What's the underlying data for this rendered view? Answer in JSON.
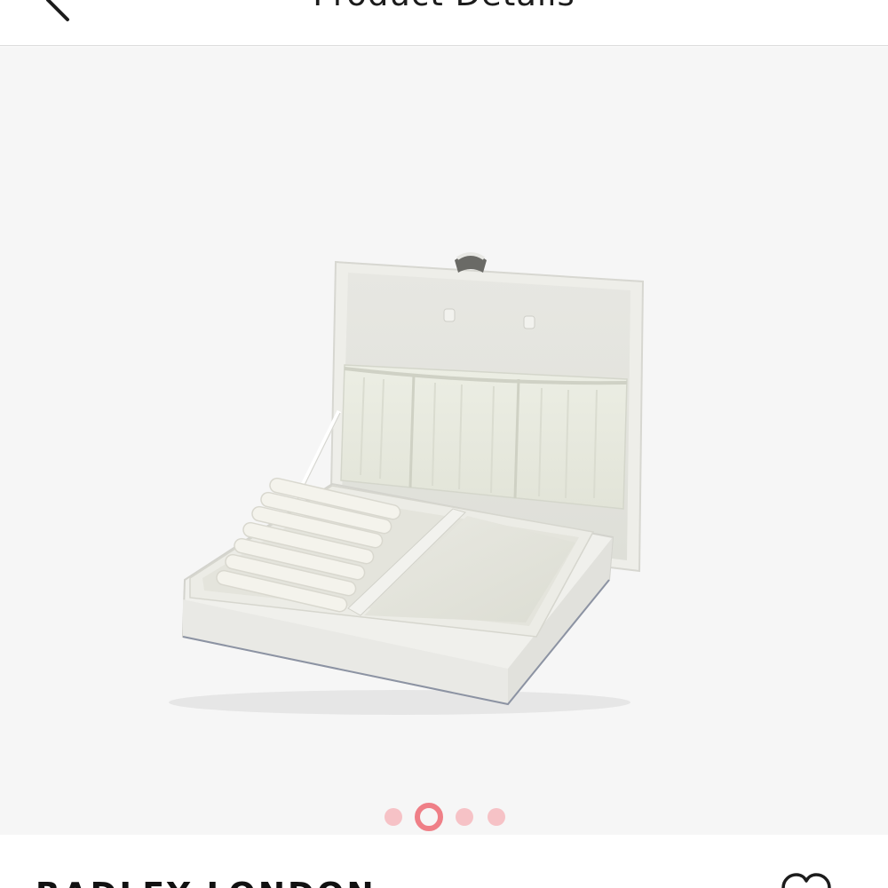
{
  "header": {
    "title": "Product Details",
    "back_icon": "chevron-left-icon"
  },
  "gallery": {
    "image_description_icon": "jewellery-box-photo",
    "dots_count": 4,
    "active_index": 1,
    "colors": {
      "active": "#ef7f87",
      "inactive": "#f6c2c6",
      "background": "#f6f6f6"
    }
  },
  "product": {
    "brand": "RADLEY LONDON",
    "wishlist_icon": "heart-outline-icon"
  }
}
